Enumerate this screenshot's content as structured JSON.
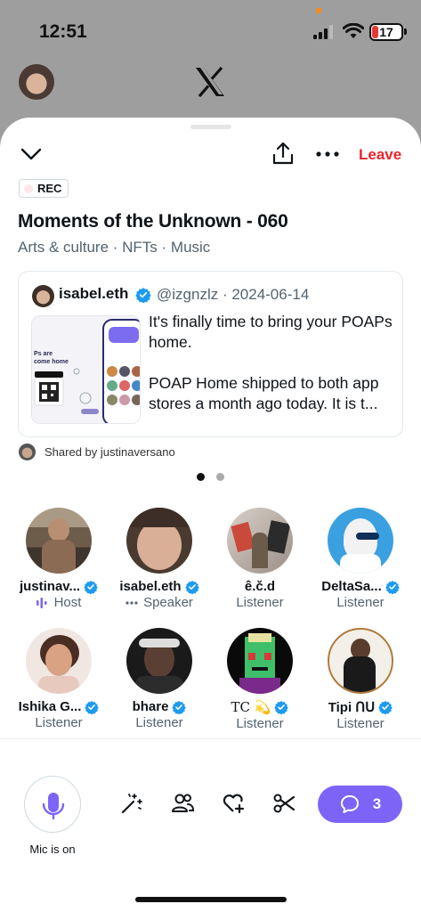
{
  "status_bar": {
    "time": "12:51",
    "battery": "17"
  },
  "header": {
    "leave_label": "Leave",
    "rec_label": "REC"
  },
  "space": {
    "title": "Moments of the Unknown - 060",
    "topics": "Arts & culture · NFTs · Music"
  },
  "pinned_post": {
    "name": "isabel.eth",
    "handle_date": "@izgnzlz · 2024-06-14",
    "text": "It's finally time to bring your POAPs home.\n\nPOAP Home shipped to both app stores a month ago today. It is t...",
    "shared_by": "Shared by justinaversano"
  },
  "participants": [
    {
      "name": "justinav...",
      "role": "Host",
      "role_icon": "sound-wave-icon",
      "verified": true
    },
    {
      "name": "isabel.eth",
      "role": "Speaker",
      "role_icon": "dots-icon",
      "verified": true
    },
    {
      "name": "ê.č.d",
      "role": "Listener",
      "verified": false
    },
    {
      "name": "DeltaSa...",
      "role": "Listener",
      "verified": true
    },
    {
      "name": "Ishika G...",
      "role": "Listener",
      "verified": true
    },
    {
      "name": "bhare",
      "role": "Listener",
      "verified": true
    },
    {
      "name": "TC 💫",
      "role": "Listener",
      "verified": true
    },
    {
      "name": "Tipi ՈՍ",
      "role": "Listener",
      "verified": true
    }
  ],
  "controls": {
    "mic_label": "Mic is on",
    "comment_count": "3",
    "tools": [
      "magic-wand-icon",
      "people-icon",
      "heart-plus-icon",
      "scissors-icon"
    ]
  },
  "colors": {
    "accent": "#7e64f6",
    "leave": "#e8252d",
    "verified": "#1d9bf0"
  }
}
